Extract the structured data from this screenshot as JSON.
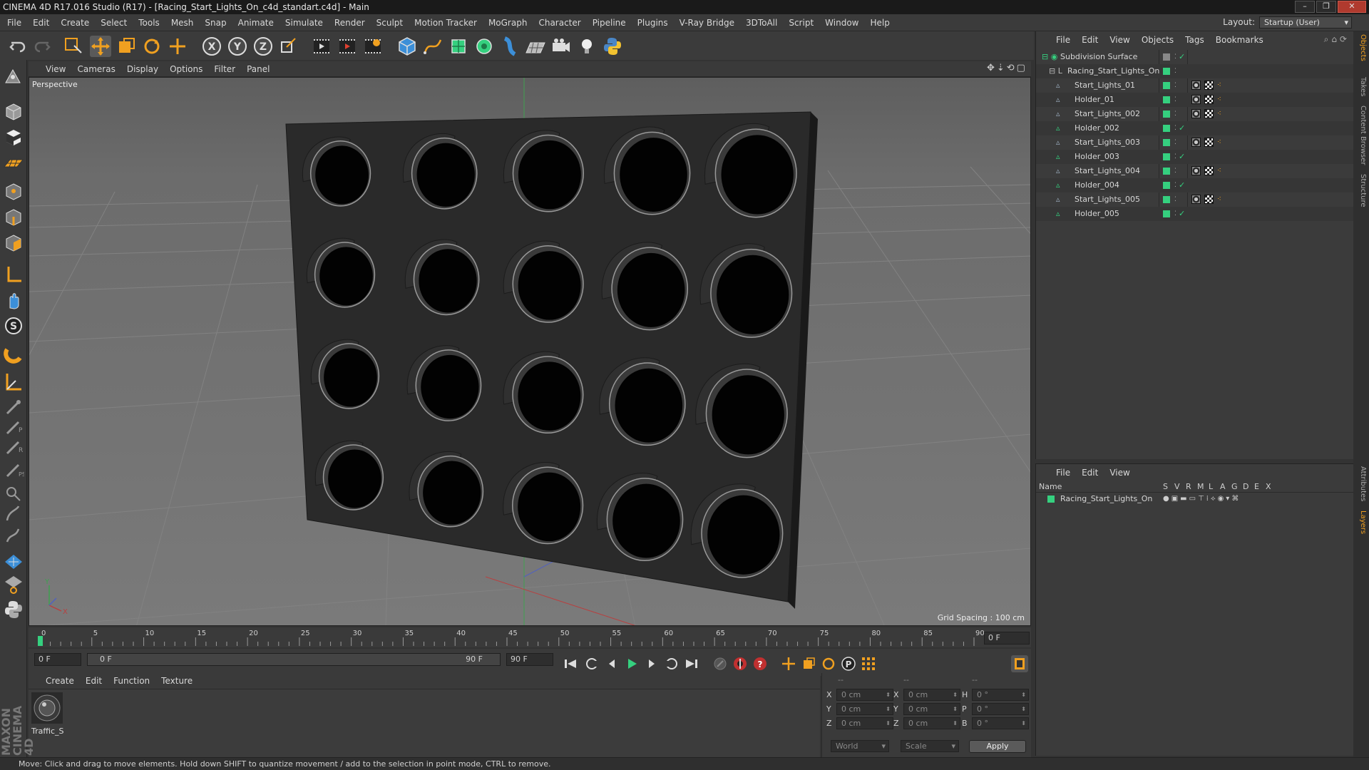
{
  "window": {
    "title": "CINEMA 4D R17.016 Studio (R17) - [Racing_Start_Lights_On_c4d_standart.c4d] - Main"
  },
  "menubar": {
    "items": [
      "File",
      "Edit",
      "Create",
      "Select",
      "Tools",
      "Mesh",
      "Snap",
      "Animate",
      "Simulate",
      "Render",
      "Sculpt",
      "Motion Tracker",
      "MoGraph",
      "Character",
      "Pipeline",
      "Plugins",
      "V-Ray Bridge",
      "3DToAll",
      "Script",
      "Window",
      "Help"
    ],
    "layout_label": "Layout:",
    "layout_value": "Startup (User)"
  },
  "viewport": {
    "menu": [
      "View",
      "Cameras",
      "Display",
      "Options",
      "Filter",
      "Panel"
    ],
    "label": "Perspective",
    "grid_spacing": "Grid Spacing : 100 cm",
    "axis_x": "X",
    "axis_y": "Y"
  },
  "timeline": {
    "ticks": [
      "0",
      "5",
      "10",
      "15",
      "20",
      "25",
      "30",
      "35",
      "40",
      "45",
      "50",
      "55",
      "60",
      "65",
      "70",
      "75",
      "80",
      "85",
      "90"
    ],
    "current_frame": "0 F",
    "start_frame": "0 F",
    "range_start": "0 F",
    "range_end": "90 F",
    "end_frame": "90 F"
  },
  "material_manager": {
    "menu": [
      "Create",
      "Edit",
      "Function",
      "Texture"
    ],
    "materials": [
      {
        "name": "Traffic_S"
      }
    ]
  },
  "coords": {
    "header": [
      "--",
      "--",
      "--"
    ],
    "rows": [
      {
        "l1": "X",
        "v1": "0 cm",
        "l2": "X",
        "v2": "0 cm",
        "l3": "H",
        "v3": "0 °"
      },
      {
        "l1": "Y",
        "v1": "0 cm",
        "l2": "Y",
        "v2": "0 cm",
        "l3": "P",
        "v3": "0 °"
      },
      {
        "l1": "Z",
        "v1": "0 cm",
        "l2": "Z",
        "v2": "0 cm",
        "l3": "B",
        "v3": "0 °"
      }
    ],
    "mode1": "World",
    "mode2": "Scale",
    "apply": "Apply"
  },
  "object_manager": {
    "menu": [
      "File",
      "Edit",
      "View",
      "Objects",
      "Tags",
      "Bookmarks"
    ],
    "objects": [
      {
        "name": "Subdivision Surface",
        "indent": 0,
        "tags": false
      },
      {
        "name": "Racing_Start_Lights_On",
        "indent": 1,
        "tags": false
      },
      {
        "name": "Start_Lights_01",
        "indent": 2,
        "tags": true
      },
      {
        "name": "Holder_01",
        "indent": 2,
        "tags": true
      },
      {
        "name": "Start_Lights_002",
        "indent": 2,
        "tags": true
      },
      {
        "name": "Holder_002",
        "indent": 2,
        "tags": false
      },
      {
        "name": "Start_Lights_003",
        "indent": 2,
        "tags": true
      },
      {
        "name": "Holder_003",
        "indent": 2,
        "tags": false
      },
      {
        "name": "Start_Lights_004",
        "indent": 2,
        "tags": true
      },
      {
        "name": "Holder_004",
        "indent": 2,
        "tags": false
      },
      {
        "name": "Start_Lights_005",
        "indent": 2,
        "tags": true
      },
      {
        "name": "Holder_005",
        "indent": 2,
        "tags": false
      }
    ]
  },
  "layer_manager": {
    "menu": [
      "File",
      "Edit",
      "View"
    ],
    "columns": [
      "Name",
      "S",
      "V",
      "R",
      "M",
      "L",
      "A",
      "G",
      "D",
      "E",
      "X"
    ],
    "layers": [
      {
        "name": "Racing_Start_Lights_On",
        "color": "#35d07f"
      }
    ]
  },
  "right_tabs": [
    "Objects",
    "Takes",
    "Content Browser",
    "Structure",
    "Attributes",
    "Layers"
  ],
  "brand": "MAXON CINEMA 4D",
  "status": {
    "text": "Move: Click and drag to move elements. Hold down SHIFT to quantize movement / add to the selection in point mode, CTRL to remove."
  },
  "colors": {
    "accent": "#35d07f",
    "toolbar_blue": "#3c8fd8",
    "toolbar_orange": "#f0a020"
  }
}
